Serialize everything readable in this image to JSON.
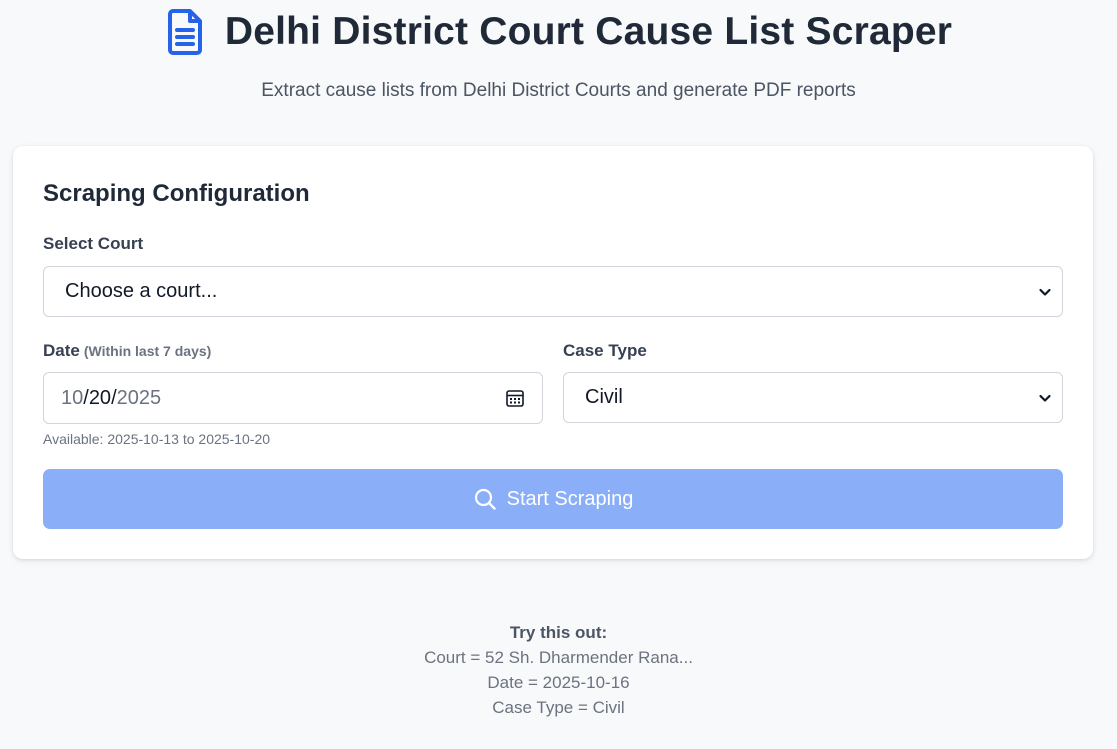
{
  "header": {
    "title": "Delhi District Court Cause List Scraper",
    "subtitle": "Extract cause lists from Delhi District Courts and generate PDF reports",
    "icon": "document-icon",
    "accent_color": "#2563eb"
  },
  "form": {
    "title": "Scraping Configuration",
    "court": {
      "label": "Select Court",
      "selected": "Choose a court..."
    },
    "date": {
      "label": "Date",
      "hint": "(Within last 7 days)",
      "month": "10",
      "day": "20",
      "year": "2025",
      "helper": "Available: 2025-10-13 to 2025-10-20"
    },
    "case_type": {
      "label": "Case Type",
      "selected": "Civil"
    },
    "submit": {
      "label": "Start Scraping",
      "icon": "search-icon",
      "color": "#8aaff8"
    }
  },
  "tip": {
    "title": "Try this out:",
    "lines": [
      "Court = 52 Sh. Dharmender Rana...",
      "Date = 2025-10-16",
      "Case Type = Civil"
    ]
  }
}
